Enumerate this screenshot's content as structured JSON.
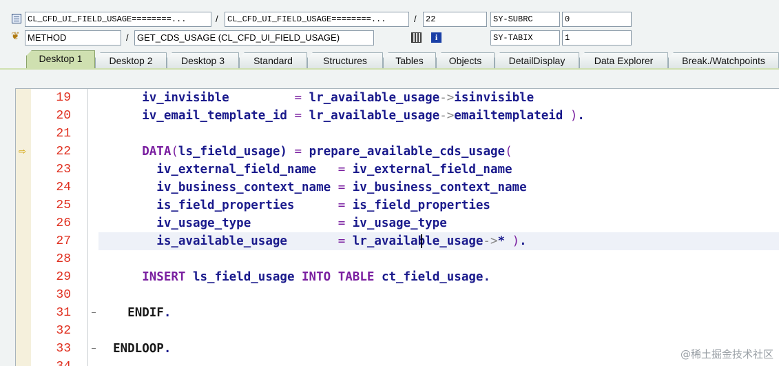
{
  "header": {
    "program": "CL_CFD_UI_FIELD_USAGE========...",
    "include": "CL_CFD_UI_FIELD_USAGE========...",
    "line_no": "22",
    "sep1": "/",
    "sep2": "/",
    "sep3": "/",
    "event_type": "METHOD",
    "event_name": "GET_CDS_USAGE (CL_CFD_UI_FIELD_USAGE)",
    "var1_name": "SY-SUBRC",
    "var1_value": "0",
    "var2_name": "SY-TABIX",
    "var2_value": "1"
  },
  "tabs": [
    {
      "label": "Desktop 1",
      "active": true
    },
    {
      "label": "Desktop 2"
    },
    {
      "label": "Desktop 3"
    },
    {
      "label": "Standard"
    },
    {
      "label": "Structures"
    },
    {
      "label": "Tables"
    },
    {
      "label": "Objects"
    },
    {
      "label": "DetailDisplay"
    },
    {
      "label": "Data Explorer"
    },
    {
      "label": "Break./Watchpoints"
    }
  ],
  "editor": {
    "current_line": "22",
    "lines": [
      {
        "n": "19",
        "text": "      iv_invisible         = lr_available_usage->isinvisible"
      },
      {
        "n": "20",
        "text": "      iv_email_template_id = lr_available_usage->emailtemplateid )."
      },
      {
        "n": "21",
        "text": ""
      },
      {
        "n": "22",
        "text": "      DATA(ls_field_usage) = prepare_available_cds_usage("
      },
      {
        "n": "23",
        "text": "        iv_external_field_name   = iv_external_field_name"
      },
      {
        "n": "24",
        "text": "        iv_business_context_name = iv_business_context_name"
      },
      {
        "n": "25",
        "text": "        is_field_properties      = is_field_properties"
      },
      {
        "n": "26",
        "text": "        iv_usage_type            = iv_usage_type"
      },
      {
        "n": "27",
        "text": "        is_available_usage       = lr_available_usage->* )."
      },
      {
        "n": "28",
        "text": ""
      },
      {
        "n": "29",
        "text": "      INSERT ls_field_usage INTO TABLE ct_field_usage."
      },
      {
        "n": "30",
        "text": ""
      },
      {
        "n": "31",
        "text": "    ENDIF."
      },
      {
        "n": "32",
        "text": ""
      },
      {
        "n": "33",
        "text": "  ENDLOOP."
      },
      {
        "n": "34",
        "text": ""
      }
    ]
  },
  "watermark": "@稀土掘金技术社区",
  "colors": {
    "line_numbers": "#e03020",
    "keyword": "#7a1fa0",
    "identifier": "#1a1a8c",
    "active_tab": "#cfe0b0"
  }
}
